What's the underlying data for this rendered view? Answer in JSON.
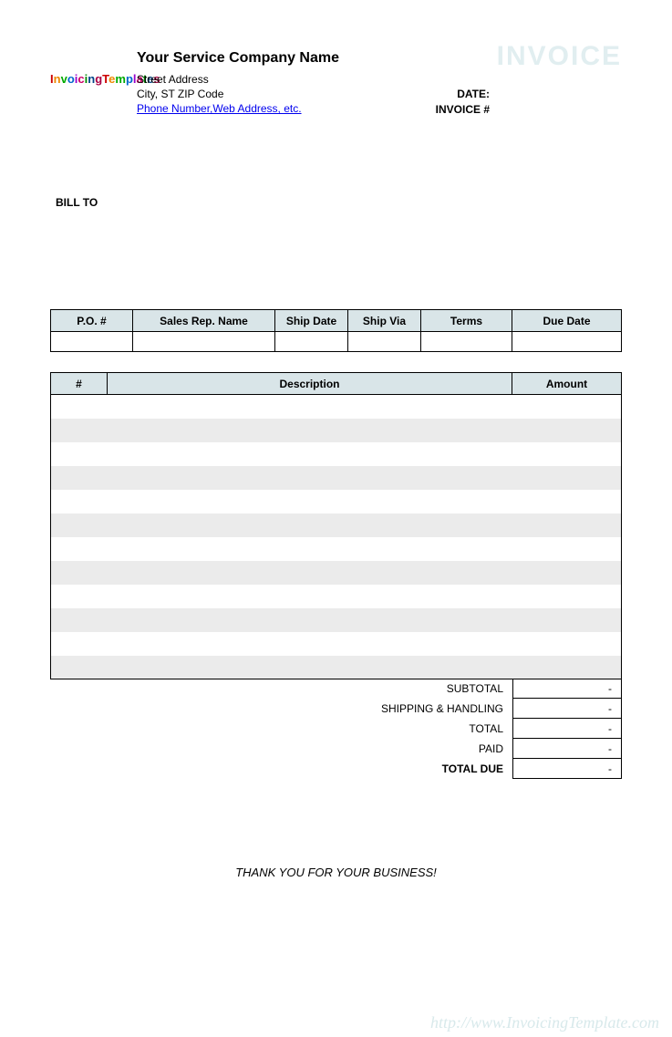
{
  "header": {
    "logo_text": "InvoicingTemplates",
    "company_name": "Your Service Company Name",
    "street": "Street Address",
    "city_line": "City, ST  ZIP Code",
    "contact_link": "Phone Number,Web Address, etc.",
    "invoice_word": "INVOICE",
    "date_label": "DATE:",
    "invoice_num_label": "INVOICE #"
  },
  "bill_to_label": "BILL TO",
  "info_headers": {
    "po": "P.O. #",
    "sales_rep": "Sales Rep. Name",
    "ship_date": "Ship Date",
    "ship_via": "Ship Via",
    "terms": "Terms",
    "due_date": "Due Date"
  },
  "info_values": {
    "po": "",
    "sales_rep": "",
    "ship_date": "",
    "ship_via": "",
    "terms": "",
    "due_date": ""
  },
  "item_headers": {
    "num": "#",
    "desc": "Description",
    "amount": "Amount"
  },
  "item_rows": 12,
  "totals": {
    "subtotal_label": "SUBTOTAL",
    "subtotal_val": "-",
    "shipping_label": "SHIPPING & HANDLING",
    "shipping_val": "-",
    "total_label": "TOTAL",
    "total_val": "-",
    "paid_label": "PAID",
    "paid_val": "-",
    "due_label": "TOTAL DUE",
    "due_val": "-"
  },
  "thanks": "THANK YOU FOR YOUR BUSINESS!",
  "watermark": "http://www.InvoicingTemplate.com"
}
